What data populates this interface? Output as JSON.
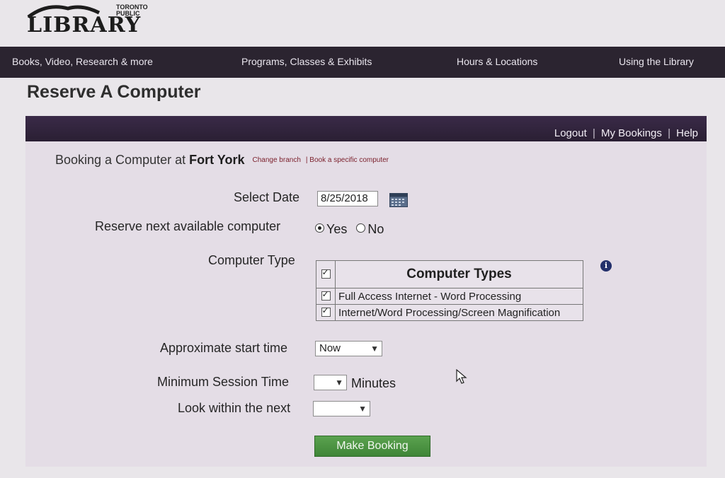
{
  "logo": {
    "small_line1": "TORONTO",
    "small_line2": "PUBLIC",
    "word": "LIBRARY"
  },
  "nav": {
    "items": [
      "Books, Video, Research & more",
      "Programs, Classes & Exhibits",
      "Hours & Locations",
      "Using the Library"
    ]
  },
  "page": {
    "title": "Reserve A Computer"
  },
  "panel": {
    "links": {
      "logout": "Logout",
      "my_bookings": "My Bookings",
      "help": "Help",
      "sep": "|"
    },
    "booking": {
      "prefix": "Booking a Computer at",
      "branch": "Fort York",
      "change_branch": "Change branch",
      "book_specific": "| Book a specific computer"
    }
  },
  "form": {
    "select_date_label": "Select Date",
    "date_value": "8/25/2018",
    "reserve_next_label": "Reserve next available computer",
    "yes": "Yes",
    "no": "No",
    "computer_type_label": "Computer Type",
    "table_header": "Computer Types",
    "computer_types": [
      "Full Access Internet - Word Processing",
      "Internet/Word Processing/Screen Magnification"
    ],
    "start_time_label": "Approximate start time",
    "start_time_value": "Now",
    "min_session_label": "Minimum Session Time",
    "minutes": "Minutes",
    "look_within_label": "Look within the next",
    "submit": "Make Booking"
  },
  "colors": {
    "nav_bg": "#2b2430",
    "panel_bar": "#2a1f33",
    "button_green": "#4a9440",
    "link_red": "#7a1e2a"
  }
}
